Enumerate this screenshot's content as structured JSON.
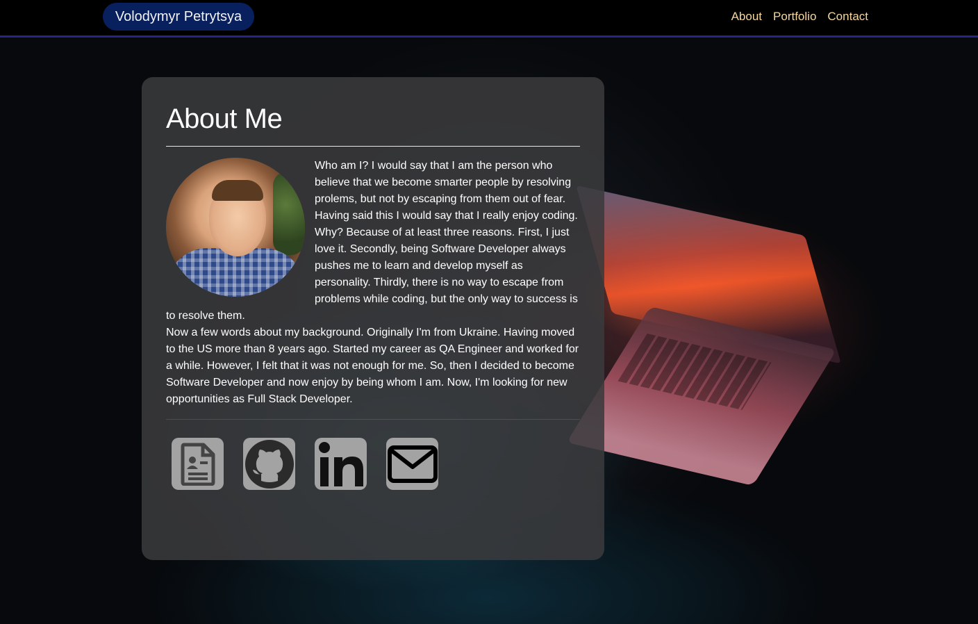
{
  "navbar": {
    "brand": "Volodymyr Petrytsya",
    "links": [
      "About",
      "Portfolio",
      "Contact"
    ]
  },
  "about": {
    "title": "About Me",
    "paragraph1": "Who am I? I would say that I am the person who believe that we become smarter people by resolving prolems, but not by escaping from them out of fear. Having said this I would say that I really enjoy coding. Why? Because of at least three reasons. First, I just love it. Secondly, being Software Developer always pushes me to learn and develop myself as personality. Thirdly, there is no way to escape from problems while coding, but the only way to success is to resolve them.",
    "paragraph2": "Now a few words about my background. Originally I'm from Ukraine. Having moved to the US more than 8 years ago. Started my career as QA Engineer and worked for a while. However, I felt that it was not enough for me. So, then I decided to become Software Developer and now enjoy by being whom I am. Now, I'm looking for new opportunities as Full Stack Developer."
  },
  "social_icons": [
    "resume-icon",
    "github-icon",
    "linkedin-icon",
    "email-icon"
  ],
  "colors": {
    "navbar_bg": "#000000",
    "navbar_border": "#2a2486",
    "brand_bg": "#08205e",
    "nav_link": "#f5d79f",
    "card_bg": "#3a3a3c",
    "icon_bg": "#a3a3a3"
  }
}
